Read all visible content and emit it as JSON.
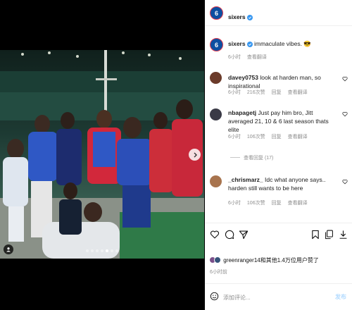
{
  "post": {
    "username": "sixers",
    "avatar_text": "6",
    "caption": "immaculate vibes. 😎",
    "caption_time": "6小时",
    "caption_translate": "查看翻译",
    "likes_text": "green​ranger14和其他1.4万位用户赞了",
    "post_time": "6小时前",
    "comment_placeholder": "添加评论...",
    "post_button": "发布"
  },
  "comments": [
    {
      "username": "davey0753",
      "text": "look at harden man, so inspirational",
      "time": "6小时",
      "likes": "216次赞",
      "reply": "回复",
      "translate": "查看翻译",
      "avatar_color": "#6b3b2a"
    },
    {
      "username": "nbapagetj",
      "text": "Just pay him bro, Jitt averaged 21, 10 & 6 last season thats elite",
      "time": "6小时",
      "likes": "106次赞",
      "reply": "回复",
      "translate": "查看翻译",
      "avatar_color": "#3a3a46"
    },
    {
      "username": "_chrismarz_",
      "text": "Idc what anyone says.. harden still wants to be here",
      "time": "6小时",
      "likes": "106次赞",
      "reply": "回复",
      "translate": "查看翻译",
      "avatar_color": "#a8744e"
    }
  ],
  "replies_toggle": "查看回复 (17)",
  "icons": {
    "like": "heart-icon",
    "comment": "comment-icon",
    "share": "send-icon",
    "save": "bookmark-icon",
    "copy": "copy-icon",
    "download": "download-icon",
    "emoji": "smile-icon",
    "next": "chevron-right-icon",
    "tag": "user-tag-icon"
  },
  "carousel": {
    "total_slides": 7,
    "active_slide": 4
  },
  "colors": {
    "verified": "#3897f0",
    "sixers_blue": "#0d4fa1",
    "sixers_red": "#e23c4f",
    "muted": "#8e8e8e",
    "post_button_disabled": "#b3dbff"
  }
}
